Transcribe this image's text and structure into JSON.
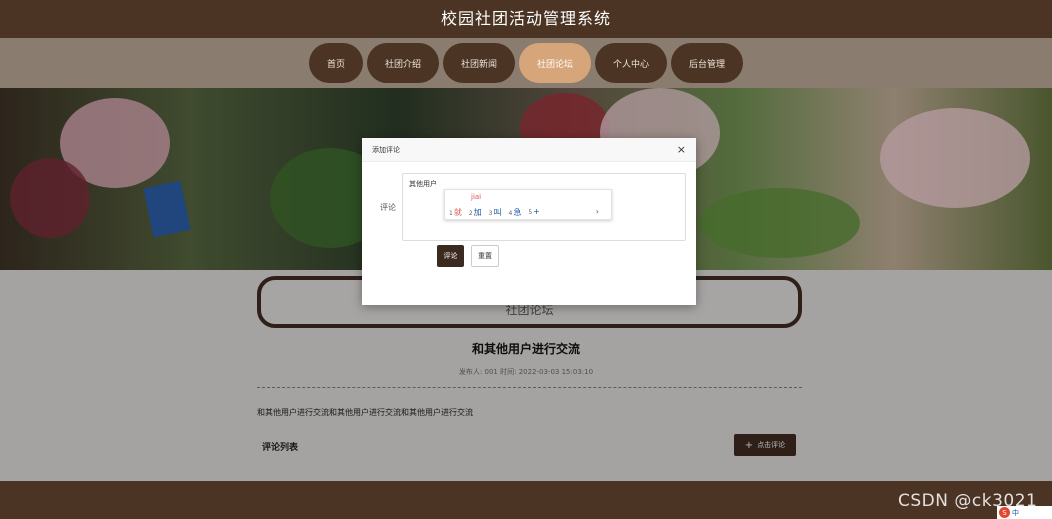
{
  "header": {
    "title": "校园社团活动管理系统"
  },
  "nav": {
    "items": [
      {
        "label": "首页",
        "active": false
      },
      {
        "label": "社团介绍",
        "active": false
      },
      {
        "label": "社团新闻",
        "active": false
      },
      {
        "label": "社团论坛",
        "active": true
      },
      {
        "label": "个人中心",
        "active": false
      },
      {
        "label": "后台管理",
        "active": false
      }
    ]
  },
  "section": {
    "title": "社团论坛"
  },
  "post": {
    "title": "和其他用户进行交流",
    "meta": "发布人: 001 时间: 2022-03-03 15:03:10",
    "body": "和其他用户进行交流和其他用户进行交流和其他用户进行交流"
  },
  "comments": {
    "list_title": "评论列表",
    "add_button": "点击评论",
    "add_icon": "+"
  },
  "modal": {
    "title": "添加评论",
    "close_icon": "×",
    "label": "评论",
    "textarea_value": "其他用户",
    "submit_label": "评论",
    "reset_label": "重置"
  },
  "ime": {
    "composition": "jiai",
    "candidates": [
      {
        "num": "1",
        "text": "就"
      },
      {
        "num": "2",
        "text": "加"
      },
      {
        "num": "3",
        "text": "叫"
      },
      {
        "num": "4",
        "text": "急"
      },
      {
        "num": "5",
        "text": "+"
      }
    ],
    "next_icon": "›"
  },
  "watermark": "CSDN @ck3021",
  "tray": {
    "logo": "S",
    "lang": "中"
  },
  "colors": {
    "brand": "#4b3424",
    "nav_active": "#d7a57a",
    "nav_bar": "#8a7d6f"
  }
}
